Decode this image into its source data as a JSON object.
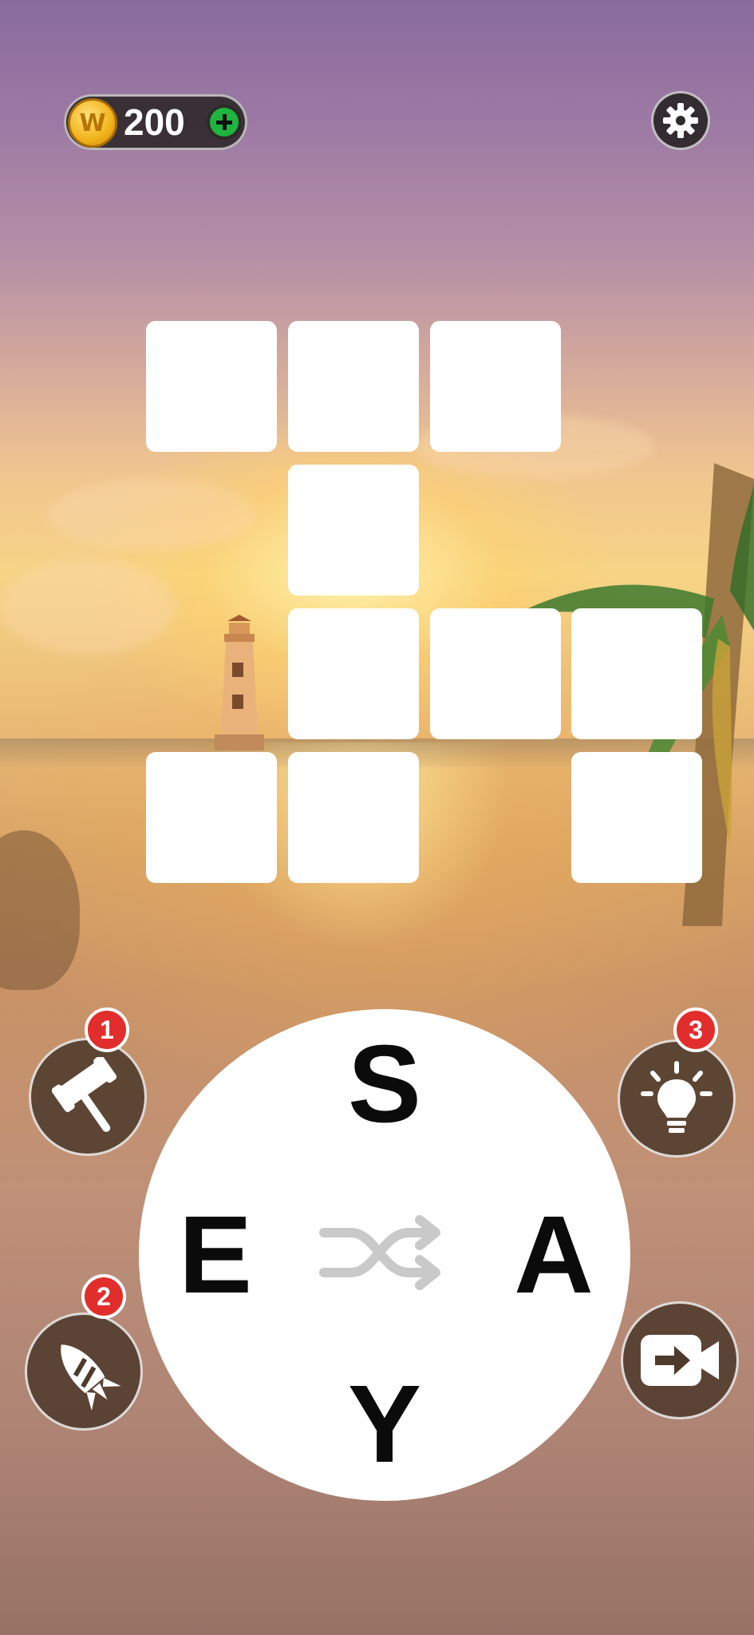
{
  "currency": {
    "coin_symbol": "W",
    "amount": "200",
    "add_icon": "plus-icon"
  },
  "settings": {
    "icon": "gear-icon"
  },
  "puzzle_grid": {
    "rows": 4,
    "cols": 4,
    "filled_cells": [
      [
        0,
        1
      ],
      [
        0,
        2
      ],
      [
        0,
        3
      ],
      [
        1,
        2
      ],
      [
        2,
        2
      ],
      [
        2,
        3
      ],
      [
        2,
        4
      ],
      [
        3,
        1
      ],
      [
        3,
        2
      ],
      [
        3,
        4
      ]
    ],
    "revealed_letters": []
  },
  "letter_wheel": {
    "letters": [
      "S",
      "A",
      "Y",
      "E"
    ],
    "shuffle_icon": "shuffle-icon"
  },
  "boosters": {
    "hammer": {
      "icon": "hammer-icon",
      "count": "1"
    },
    "rocket": {
      "icon": "rocket-icon",
      "count": "2"
    },
    "hint": {
      "icon": "lightbulb-icon",
      "count": "3"
    },
    "video": {
      "icon": "video-arrow-icon"
    }
  }
}
